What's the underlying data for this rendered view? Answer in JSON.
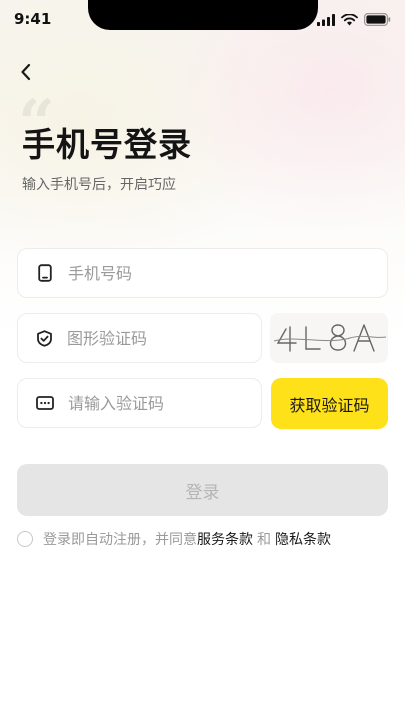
{
  "status_bar": {
    "time": "9:41"
  },
  "header": {
    "title": "手机号登录",
    "subtitle": "输入手机号后，开启巧应"
  },
  "form": {
    "phone_placeholder": "手机号码",
    "captcha_placeholder": "图形验证码",
    "captcha_text": "4L8A",
    "code_placeholder": "请输入验证码",
    "get_code_label": "获取验证码",
    "login_label": "登录"
  },
  "agreement": {
    "prefix": "登录即自动注册，并同意",
    "terms_label": "服务条款",
    "conjunction": "和",
    "privacy_label": "隐私条款"
  },
  "colors": {
    "accent": "#ffe11a",
    "disabled_button": "#e5e5e5",
    "disabled_text": "#b5b5b5",
    "muted_text": "#9a9a9a"
  },
  "icons": {
    "back": "chevron-left-icon",
    "phone": "phone-icon",
    "captcha": "shield-check-icon",
    "code": "message-dots-icon"
  }
}
